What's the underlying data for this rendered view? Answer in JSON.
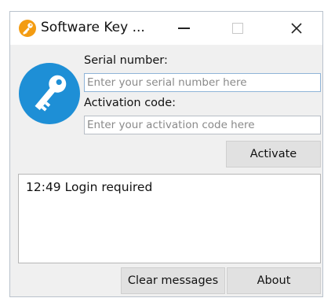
{
  "window": {
    "title": "Software Key ...",
    "minimize_glyph": "—",
    "close_glyph": "✕"
  },
  "icons": {
    "app": "key-icon-orange",
    "badge": "key-icon-blue",
    "accent": "#f39c12",
    "badge_color": "#1e8fd6"
  },
  "form": {
    "serial_label": "Serial number:",
    "serial_placeholder": "Enter your serial number here",
    "serial_value": "",
    "activation_label": "Activation code:",
    "activation_placeholder": "Enter your activation code here",
    "activation_value": "",
    "activate_label": "Activate"
  },
  "log": {
    "messages": [
      "12:49 Login required"
    ]
  },
  "footer": {
    "clear_label": "Clear messages",
    "about_label": "About"
  }
}
